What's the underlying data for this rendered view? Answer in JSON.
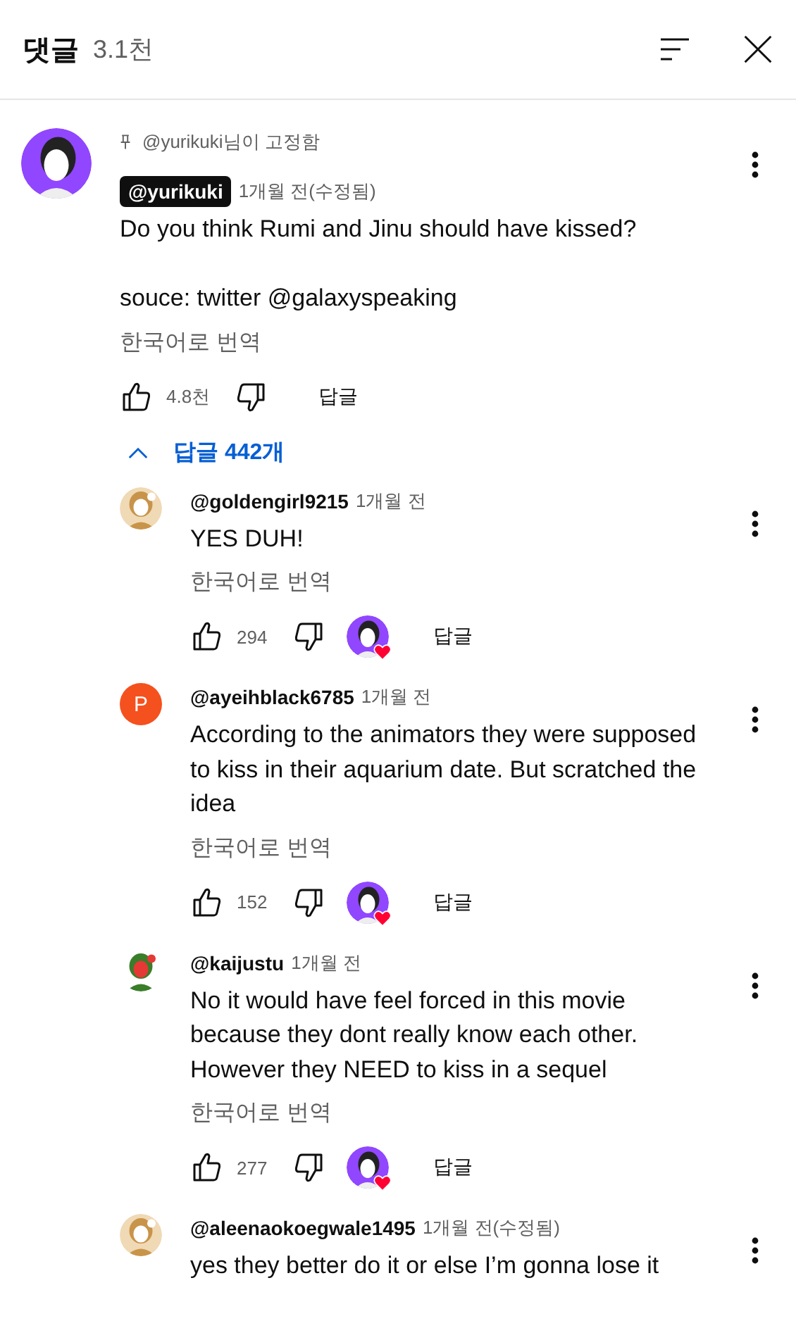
{
  "header": {
    "title": "댓글",
    "count": "3.1천"
  },
  "pinned": {
    "pinned_label": "@yurikuki님이 고정함",
    "author": "@yurikuki",
    "creator": true,
    "time": "1개월 전(수정됨)",
    "text": "Do you think Rumi and Jinu should have kissed?\n\nsouce: twitter @galaxyspeaking",
    "translate": "한국어로 번역",
    "likes": "4.8천",
    "reply_label": "답글",
    "replies_toggle": {
      "label": "답글 442개",
      "expanded": true
    }
  },
  "replies": [
    {
      "author": "@goldengirl9215",
      "time": "1개월 전",
      "text": "YES DUH!",
      "translate": "한국어로 번역",
      "likes": "294",
      "creator_heart": true,
      "reply_label": "답글"
    },
    {
      "avatar": {
        "kind": "letter",
        "letter": "P",
        "color": "#f4511e"
      },
      "author": "@ayeihblack6785",
      "time": "1개월 전",
      "text": "According to the animators they were supposed to kiss in their aquarium date. But scratched the idea",
      "translate": "한국어로 번역",
      "likes": "152",
      "creator_heart": true,
      "reply_label": "답글"
    },
    {
      "author": "@kaijustu",
      "time": "1개월 전",
      "text": "No it would have feel forced in this movie because they dont really know each other. However they NEED to kiss in a sequel",
      "translate": "한국어로 번역",
      "likes": "277",
      "creator_heart": true,
      "reply_label": "답글"
    },
    {
      "author": "@aleenaokoegwale1495",
      "time": "1개월 전(수정됨)",
      "text": "yes they better do it or else I’m gonna lose it"
    }
  ]
}
